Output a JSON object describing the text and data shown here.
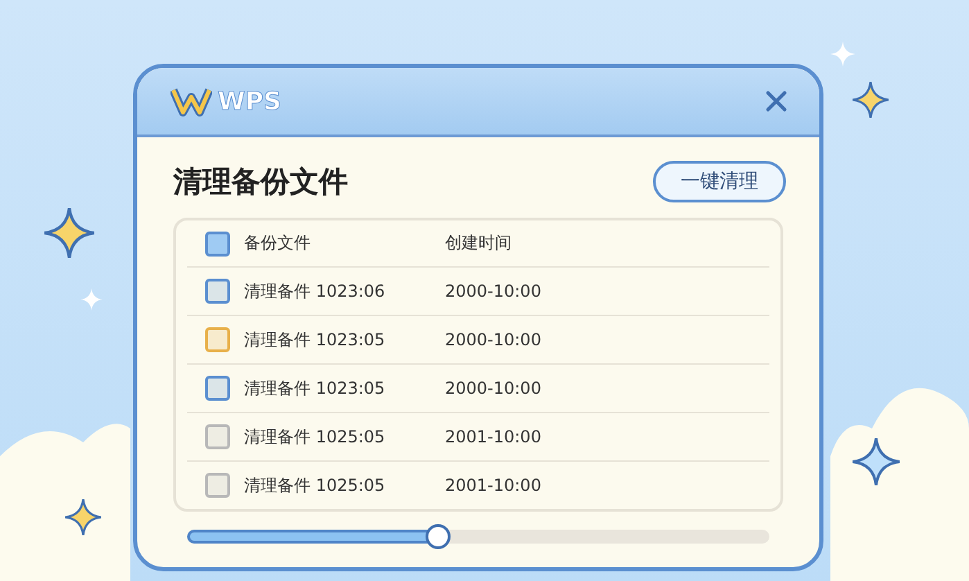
{
  "window": {
    "logo_text": "WPS",
    "title": "清理备份文件",
    "action_button": "一键清理"
  },
  "table": {
    "header": {
      "checked": true,
      "columns": [
        "备份文件",
        "创建时间"
      ]
    },
    "rows": [
      {
        "name": "清理备件 1023:06",
        "time": "2000-10:00",
        "color": "#5b8fd0"
      },
      {
        "name": "清理备件 1023:05",
        "time": "2000-10:00",
        "color": "#e8b04a"
      },
      {
        "name": "清理备件 1023:05",
        "time": "2000-10:00",
        "color": "#5b8fd0"
      },
      {
        "name": "清理备件 1025:05",
        "time": "2001-10:00",
        "color": "#b8b8b8"
      },
      {
        "name": "清理备件 1025:05",
        "time": "2001-10:00",
        "color": "#b8b8b8"
      }
    ]
  },
  "progress": {
    "level": 0.43
  }
}
